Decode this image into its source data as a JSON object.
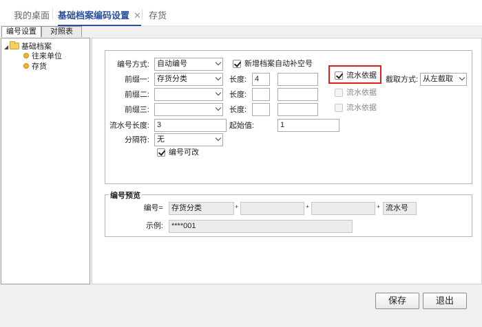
{
  "top_tabs": {
    "desktop": "我的桌面",
    "coding": "基础档案编码设置",
    "close": "✕",
    "inventory": "存货"
  },
  "sub_tabs": {
    "numbering": "编号设置",
    "lookup": "对照表"
  },
  "tree": {
    "toggle": "◢",
    "root": "基础档案",
    "items": [
      "往来单位",
      "存货"
    ]
  },
  "form": {
    "mode_label": "编号方式:",
    "mode_value": "自动编号",
    "auto_fill_label": "新增档案自动补空号",
    "auto_fill_checked": true,
    "prefix1_label": "前缀一:",
    "prefix1_value": "存货分类",
    "prefix2_label": "前缀二:",
    "prefix2_value": "",
    "prefix3_label": "前缀三:",
    "prefix3_value": "",
    "length_label": "长度:",
    "length1_value": "4",
    "length2_value": "",
    "length3_value": "",
    "serial_basis_label": "流水依据",
    "serial_basis1_checked": true,
    "cut_mode_label": "截取方式:",
    "cut_mode_value": "从左截取",
    "serial_length_label": "流水号长度:",
    "serial_length_value": "3",
    "start_label": "起始值:",
    "start_value": "1",
    "separator_label": "分隔符:",
    "separator_value": "无",
    "editable_label": "编号可改",
    "editable_checked": true
  },
  "preview": {
    "legend": "编号预览",
    "code_label": "编号=",
    "part1": "存货分类",
    "plus": "+",
    "part2": "",
    "part3": "",
    "part4": "流水号",
    "example_label": "示例:",
    "example_value": "****001"
  },
  "buttons": {
    "save": "保存",
    "exit": "退出"
  },
  "colors": {
    "accent": "#2a4f9e",
    "highlight_box": "#e21b1b"
  }
}
